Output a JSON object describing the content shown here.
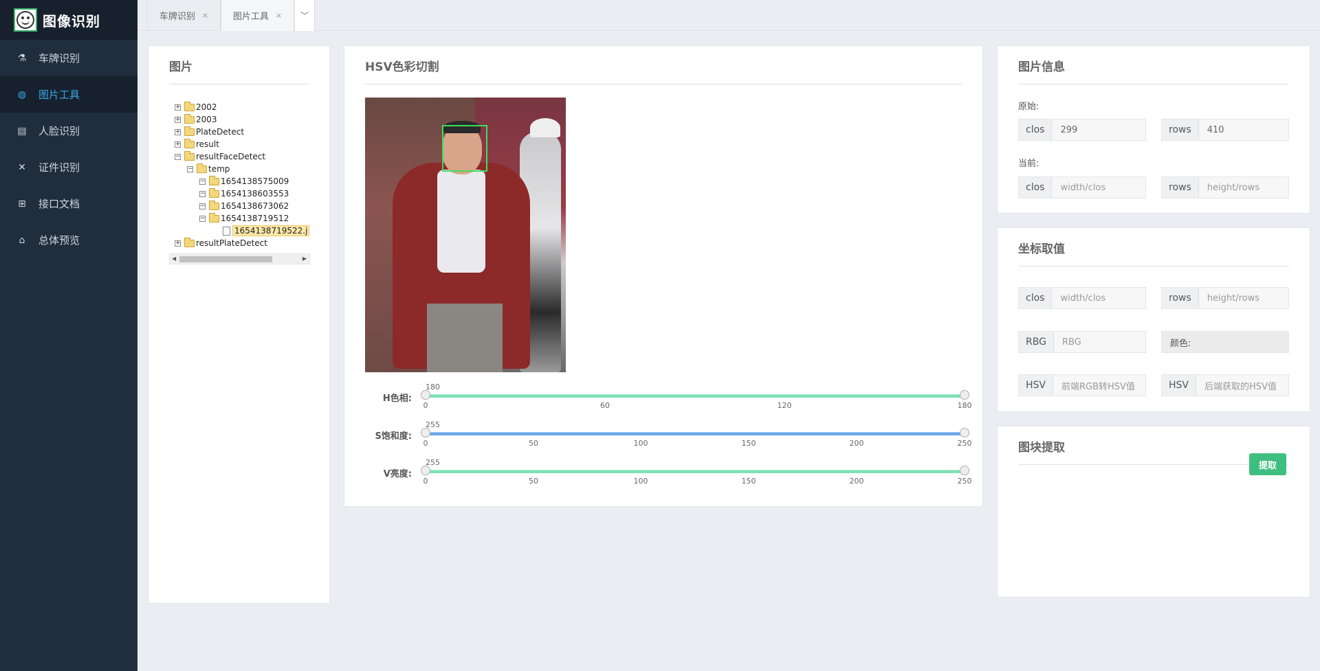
{
  "app": {
    "title": "图像识别"
  },
  "sidebar": {
    "items": [
      {
        "label": "车牌识别",
        "icon": "flask-icon"
      },
      {
        "label": "图片工具",
        "icon": "globe-icon",
        "active": true
      },
      {
        "label": "人脸识别",
        "icon": "clipboard-icon"
      },
      {
        "label": "证件识别",
        "icon": "tools-icon"
      },
      {
        "label": "接口文档",
        "icon": "book-icon"
      },
      {
        "label": "总体预览",
        "icon": "home-icon"
      }
    ]
  },
  "tabs": [
    {
      "label": "车牌识别",
      "close": "×"
    },
    {
      "label": "图片工具",
      "close": "×",
      "active": true
    }
  ],
  "picture_panel": {
    "title": "图片",
    "tree": [
      {
        "label": "2002",
        "toggle": "+"
      },
      {
        "label": "2003",
        "toggle": "+"
      },
      {
        "label": "PlateDetect",
        "toggle": "+"
      },
      {
        "label": "result",
        "toggle": "+"
      },
      {
        "label": "resultFaceDetect",
        "toggle": "−"
      },
      {
        "label": "temp",
        "toggle": "−"
      },
      {
        "label": "1654138575009",
        "toggle": "−"
      },
      {
        "label": "1654138603553",
        "toggle": "−"
      },
      {
        "label": "1654138673062",
        "toggle": "−"
      },
      {
        "label": "1654138719512",
        "toggle": "−"
      },
      {
        "label": "1654138719522.j",
        "selected": true
      },
      {
        "label": "resultPlateDetect",
        "toggle": "+"
      }
    ]
  },
  "hsv_panel": {
    "title": "HSV色彩切割",
    "sliders": [
      {
        "label": "H色相:",
        "max_value": "180",
        "ticks": [
          "0",
          "60",
          "120",
          "180"
        ],
        "color": "#7fe0b5"
      },
      {
        "label": "S饱和度:",
        "max_value": "255",
        "ticks": [
          "0",
          "50",
          "100",
          "150",
          "200",
          "250"
        ],
        "color": "#6aa8e8"
      },
      {
        "label": "V亮度:",
        "max_value": "255",
        "ticks": [
          "0",
          "50",
          "100",
          "150",
          "200",
          "250"
        ],
        "color": "#7fe0b5"
      }
    ]
  },
  "info_panel": {
    "title": "图片信息",
    "original_label": "原始:",
    "current_label": "当前:",
    "orig_cols_addon": "clos",
    "orig_cols_value": "299",
    "orig_rows_addon": "rows",
    "orig_rows_value": "410",
    "cur_cols_addon": "clos",
    "cur_cols_placeholder": "width/clos",
    "cur_rows_addon": "rows",
    "cur_rows_placeholder": "height/rows"
  },
  "coord_panel": {
    "title": "坐标取值",
    "cols_addon": "clos",
    "cols_placeholder": "width/clos",
    "rows_addon": "rows",
    "rows_placeholder": "height/rows",
    "rgb_addon": "RBG",
    "rgb_placeholder": "RBG",
    "color_label": "颜色:",
    "hsv1_addon": "HSV",
    "hsv1_placeholder": "前端RGB转HSV值",
    "hsv2_addon": "HSV",
    "hsv2_placeholder": "后端获取的HSV值"
  },
  "block_panel": {
    "title": "图块提取",
    "extract_button": "提取"
  },
  "colors": {
    "sidebar_bg": "#1f2d3d",
    "active_nav": "#38a8e8",
    "accent_green": "#3fbf7f"
  }
}
